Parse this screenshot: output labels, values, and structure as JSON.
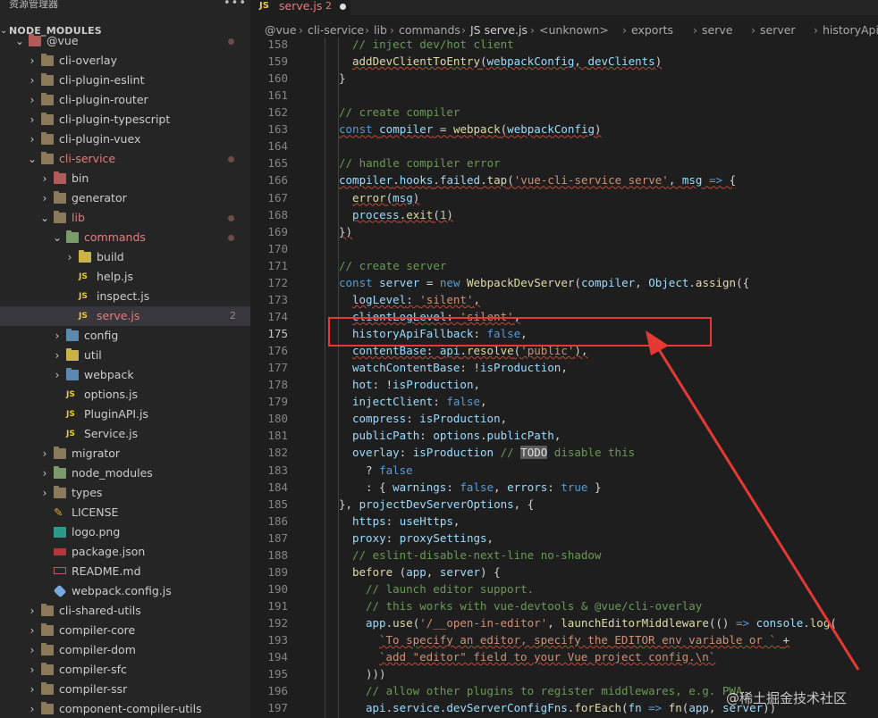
{
  "sidebar": {
    "title": "资源管理器",
    "menu": "•••",
    "section": "NODE_MODULES",
    "items": [
      {
        "label": "@vue",
        "type": "folder",
        "color": "red",
        "depth": 0,
        "open": true,
        "dot": true
      },
      {
        "label": "cli-overlay",
        "type": "folder",
        "color": "default",
        "depth": 1
      },
      {
        "label": "cli-plugin-eslint",
        "type": "folder",
        "color": "default",
        "depth": 1
      },
      {
        "label": "cli-plugin-router",
        "type": "folder",
        "color": "default",
        "depth": 1
      },
      {
        "label": "cli-plugin-typescript",
        "type": "folder",
        "color": "default",
        "depth": 1
      },
      {
        "label": "cli-plugin-vuex",
        "type": "folder",
        "color": "default",
        "depth": 1
      },
      {
        "label": "cli-service",
        "type": "folder",
        "color": "default",
        "depth": 1,
        "open": true,
        "red": true,
        "dot": true
      },
      {
        "label": "bin",
        "type": "folder",
        "color": "red",
        "depth": 2
      },
      {
        "label": "generator",
        "type": "folder",
        "color": "default",
        "depth": 2
      },
      {
        "label": "lib",
        "type": "folder",
        "color": "default",
        "depth": 2,
        "open": true,
        "red": true,
        "dot": true
      },
      {
        "label": "commands",
        "type": "folder",
        "color": "green",
        "depth": 3,
        "open": true,
        "red": true,
        "dot": true
      },
      {
        "label": "build",
        "type": "folder",
        "color": "yellow",
        "depth": 4
      },
      {
        "label": "help.js",
        "type": "js",
        "depth": 4
      },
      {
        "label": "inspect.js",
        "type": "js",
        "depth": 4
      },
      {
        "label": "serve.js",
        "type": "js",
        "depth": 4,
        "red": true,
        "count": "2",
        "selected": true
      },
      {
        "label": "config",
        "type": "folder",
        "color": "blue",
        "depth": 3
      },
      {
        "label": "util",
        "type": "folder",
        "color": "yellow",
        "depth": 3
      },
      {
        "label": "webpack",
        "type": "folder",
        "color": "blue",
        "depth": 3
      },
      {
        "label": "options.js",
        "type": "js",
        "depth": 3
      },
      {
        "label": "PluginAPI.js",
        "type": "js",
        "depth": 3
      },
      {
        "label": "Service.js",
        "type": "js",
        "depth": 3
      },
      {
        "label": "migrator",
        "type": "folder",
        "color": "default",
        "depth": 2
      },
      {
        "label": "node_modules",
        "type": "folder",
        "color": "green",
        "depth": 2
      },
      {
        "label": "types",
        "type": "folder",
        "color": "default",
        "depth": 2
      },
      {
        "label": "LICENSE",
        "type": "license",
        "depth": 2
      },
      {
        "label": "logo.png",
        "type": "image",
        "depth": 2
      },
      {
        "label": "package.json",
        "type": "npm",
        "depth": 2
      },
      {
        "label": "README.md",
        "type": "md",
        "depth": 2
      },
      {
        "label": "webpack.config.js",
        "type": "webpack",
        "depth": 2
      },
      {
        "label": "cli-shared-utils",
        "type": "folder",
        "color": "default",
        "depth": 1
      },
      {
        "label": "compiler-core",
        "type": "folder",
        "color": "default",
        "depth": 1
      },
      {
        "label": "compiler-dom",
        "type": "folder",
        "color": "default",
        "depth": 1
      },
      {
        "label": "compiler-sfc",
        "type": "folder",
        "color": "default",
        "depth": 1
      },
      {
        "label": "compiler-ssr",
        "type": "folder",
        "color": "default",
        "depth": 1
      },
      {
        "label": "component-compiler-utils",
        "type": "folder",
        "color": "default",
        "depth": 1
      }
    ]
  },
  "tab": {
    "icon": "JS",
    "name": "serve.js",
    "problems": "2"
  },
  "breadcrumb": [
    "@vue",
    "cli-service",
    "lib",
    "commands",
    "JS serve.js",
    "<unknown>",
    "exports",
    "serve",
    "server",
    "historyApiFallback"
  ],
  "editor": {
    "current_line": 175,
    "lines": [
      {
        "n": 158,
        "i": 2,
        "t": [
          [
            "cm",
            "// inject dev/hot client"
          ]
        ]
      },
      {
        "n": 159,
        "i": 2,
        "t": [
          [
            "fn",
            "addDevClientToEntry"
          ],
          [
            "tx",
            "("
          ],
          [
            "vr",
            "webpackConfig"
          ],
          [
            "tx",
            ", "
          ],
          [
            "vr",
            "devClients"
          ],
          [
            "tx",
            ")"
          ]
        ]
      },
      {
        "n": 160,
        "i": 1,
        "t": [
          [
            "tx",
            "}"
          ]
        ]
      },
      {
        "n": 161,
        "i": 0,
        "t": []
      },
      {
        "n": 162,
        "i": 1,
        "t": [
          [
            "cm",
            "// create compiler"
          ]
        ]
      },
      {
        "n": 163,
        "i": 1,
        "t": [
          [
            "kw",
            "const "
          ],
          [
            "vr",
            "compiler"
          ],
          [
            "tx",
            " = "
          ],
          [
            "fn",
            "webpack"
          ],
          [
            "tx",
            "("
          ],
          [
            "vr",
            "webpackConfig"
          ],
          [
            "tx",
            ")"
          ]
        ]
      },
      {
        "n": 164,
        "i": 0,
        "t": []
      },
      {
        "n": 165,
        "i": 1,
        "t": [
          [
            "cm",
            "// handle compiler error"
          ]
        ]
      },
      {
        "n": 166,
        "i": 1,
        "t": [
          [
            "vr",
            "compiler"
          ],
          [
            "tx",
            "."
          ],
          [
            "pr",
            "hooks"
          ],
          [
            "tx",
            "."
          ],
          [
            "pr",
            "failed"
          ],
          [
            "tx",
            "."
          ],
          [
            "fn",
            "tap"
          ],
          [
            "tx",
            "("
          ],
          [
            "st",
            "'vue-cli-service serve'"
          ],
          [
            "tx",
            ", "
          ],
          [
            "vr",
            "msg"
          ],
          [
            "tx",
            " "
          ],
          [
            "kw",
            "=>"
          ],
          [
            "tx",
            " {"
          ]
        ]
      },
      {
        "n": 167,
        "i": 2,
        "t": [
          [
            "fn",
            "error"
          ],
          [
            "tx",
            "("
          ],
          [
            "vr",
            "msg"
          ],
          [
            "tx",
            ")"
          ]
        ]
      },
      {
        "n": 168,
        "i": 2,
        "t": [
          [
            "vr",
            "process"
          ],
          [
            "tx",
            "."
          ],
          [
            "fn",
            "exit"
          ],
          [
            "tx",
            "("
          ],
          [
            "nu",
            "1"
          ],
          [
            "tx",
            ")"
          ]
        ]
      },
      {
        "n": 169,
        "i": 1,
        "t": [
          [
            "tx",
            "})"
          ]
        ]
      },
      {
        "n": 170,
        "i": 0,
        "t": []
      },
      {
        "n": 171,
        "i": 1,
        "t": [
          [
            "cm",
            "// create server"
          ]
        ]
      },
      {
        "n": 172,
        "i": 1,
        "t": [
          [
            "kw",
            "const "
          ],
          [
            "vr",
            "server"
          ],
          [
            "tx",
            " = "
          ],
          [
            "kw",
            "new "
          ],
          [
            "fn",
            "WebpackDevServer"
          ],
          [
            "tx",
            "("
          ],
          [
            "vr",
            "compiler"
          ],
          [
            "tx",
            ", "
          ],
          [
            "vr",
            "Object"
          ],
          [
            "tx",
            "."
          ],
          [
            "fn",
            "assign"
          ],
          [
            "tx",
            "({"
          ]
        ]
      },
      {
        "n": 173,
        "i": 2,
        "t": [
          [
            "pr",
            "logLevel"
          ],
          [
            "tx",
            ": "
          ],
          [
            "st",
            "'silent'"
          ],
          [
            "tx",
            ","
          ]
        ]
      },
      {
        "n": 174,
        "i": 2,
        "t": [
          [
            "pr",
            "clientLogLevel"
          ],
          [
            "tx",
            ": "
          ],
          [
            "st",
            "'silent'"
          ],
          [
            "tx",
            ","
          ]
        ]
      },
      {
        "n": 175,
        "i": 2,
        "t": [
          [
            "pr",
            "historyApiFallback"
          ],
          [
            "tx",
            ": "
          ],
          [
            "kw",
            "false"
          ],
          [
            "tx",
            ","
          ]
        ]
      },
      {
        "n": 176,
        "i": 2,
        "t": [
          [
            "pr",
            "contentBase"
          ],
          [
            "tx",
            ": "
          ],
          [
            "vr",
            "api"
          ],
          [
            "tx",
            "."
          ],
          [
            "fn",
            "resolve"
          ],
          [
            "tx",
            "("
          ],
          [
            "st",
            "'public'"
          ],
          [
            "tx",
            "),"
          ]
        ]
      },
      {
        "n": 177,
        "i": 2,
        "t": [
          [
            "pr",
            "watchContentBase"
          ],
          [
            "tx",
            ": !"
          ],
          [
            "vr",
            "isProduction"
          ],
          [
            "tx",
            ","
          ]
        ]
      },
      {
        "n": 178,
        "i": 2,
        "t": [
          [
            "pr",
            "hot"
          ],
          [
            "tx",
            ": !"
          ],
          [
            "vr",
            "isProduction"
          ],
          [
            "tx",
            ","
          ]
        ]
      },
      {
        "n": 179,
        "i": 2,
        "t": [
          [
            "pr",
            "injectClient"
          ],
          [
            "tx",
            ": "
          ],
          [
            "kw",
            "false"
          ],
          [
            "tx",
            ","
          ]
        ]
      },
      {
        "n": 180,
        "i": 2,
        "t": [
          [
            "pr",
            "compress"
          ],
          [
            "tx",
            ": "
          ],
          [
            "vr",
            "isProduction"
          ],
          [
            "tx",
            ","
          ]
        ]
      },
      {
        "n": 181,
        "i": 2,
        "t": [
          [
            "pr",
            "publicPath"
          ],
          [
            "tx",
            ": "
          ],
          [
            "vr",
            "options"
          ],
          [
            "tx",
            "."
          ],
          [
            "pr",
            "publicPath"
          ],
          [
            "tx",
            ","
          ]
        ]
      },
      {
        "n": 182,
        "i": 2,
        "t": [
          [
            "pr",
            "overlay"
          ],
          [
            "tx",
            ": "
          ],
          [
            "vr",
            "isProduction"
          ],
          [
            "tx",
            " "
          ],
          [
            "cm",
            "// "
          ],
          [
            "todo",
            "TODO"
          ],
          [
            "cm",
            " disable this"
          ]
        ]
      },
      {
        "n": 183,
        "i": 3,
        "t": [
          [
            "tx",
            "? "
          ],
          [
            "kw",
            "false"
          ]
        ]
      },
      {
        "n": 184,
        "i": 3,
        "t": [
          [
            "tx",
            ": { "
          ],
          [
            "pr",
            "warnings"
          ],
          [
            "tx",
            ": "
          ],
          [
            "kw",
            "false"
          ],
          [
            "tx",
            ", "
          ],
          [
            "pr",
            "errors"
          ],
          [
            "tx",
            ": "
          ],
          [
            "kw",
            "true"
          ],
          [
            "tx",
            " }"
          ]
        ]
      },
      {
        "n": 185,
        "i": 1,
        "t": [
          [
            "tx",
            "}, "
          ],
          [
            "vr",
            "projectDevServerOptions"
          ],
          [
            "tx",
            ", {"
          ]
        ]
      },
      {
        "n": 186,
        "i": 2,
        "t": [
          [
            "pr",
            "https"
          ],
          [
            "tx",
            ": "
          ],
          [
            "vr",
            "useHttps"
          ],
          [
            "tx",
            ","
          ]
        ]
      },
      {
        "n": 187,
        "i": 2,
        "t": [
          [
            "pr",
            "proxy"
          ],
          [
            "tx",
            ": "
          ],
          [
            "vr",
            "proxySettings"
          ],
          [
            "tx",
            ","
          ]
        ]
      },
      {
        "n": 188,
        "i": 2,
        "t": [
          [
            "cm",
            "// eslint-disable-next-line no-shadow"
          ]
        ]
      },
      {
        "n": 189,
        "i": 2,
        "t": [
          [
            "fn",
            "before"
          ],
          [
            "tx",
            " ("
          ],
          [
            "vr",
            "app"
          ],
          [
            "tx",
            ", "
          ],
          [
            "vr",
            "server"
          ],
          [
            "tx",
            ") {"
          ]
        ]
      },
      {
        "n": 190,
        "i": 3,
        "t": [
          [
            "cm",
            "// launch editor support."
          ]
        ]
      },
      {
        "n": 191,
        "i": 3,
        "t": [
          [
            "cm",
            "// this works with vue-devtools & @vue/cli-overlay"
          ]
        ]
      },
      {
        "n": 192,
        "i": 3,
        "t": [
          [
            "vr",
            "app"
          ],
          [
            "tx",
            "."
          ],
          [
            "fn",
            "use"
          ],
          [
            "tx",
            "("
          ],
          [
            "st",
            "'/__open-in-editor'"
          ],
          [
            "tx",
            ", "
          ],
          [
            "fn",
            "launchEditorMiddleware"
          ],
          [
            "tx",
            "(() "
          ],
          [
            "kw",
            "=>"
          ],
          [
            "tx",
            " "
          ],
          [
            "vr",
            "console"
          ],
          [
            "tx",
            "."
          ],
          [
            "fn",
            "log"
          ],
          [
            "tx",
            "("
          ]
        ]
      },
      {
        "n": 193,
        "i": 4,
        "t": [
          [
            "st",
            "`To specify an editor, specify the EDITOR env variable or ` "
          ],
          [
            "tx",
            "+"
          ]
        ]
      },
      {
        "n": 194,
        "i": 4,
        "t": [
          [
            "st",
            "`add \"editor\" field to your Vue project config.\\n`"
          ]
        ]
      },
      {
        "n": 195,
        "i": 3,
        "t": [
          [
            "tx",
            ")))"
          ]
        ]
      },
      {
        "n": 196,
        "i": 3,
        "t": [
          [
            "cm",
            "// allow other plugins to register middlewares, e.g. PWA"
          ]
        ]
      },
      {
        "n": 197,
        "i": 3,
        "t": [
          [
            "vr",
            "api"
          ],
          [
            "tx",
            "."
          ],
          [
            "pr",
            "service"
          ],
          [
            "tx",
            "."
          ],
          [
            "pr",
            "devServerConfigFns"
          ],
          [
            "tx",
            "."
          ],
          [
            "fn",
            "forEach"
          ],
          [
            "tx",
            "("
          ],
          [
            "vr",
            "fn"
          ],
          [
            "tx",
            " "
          ],
          [
            "kw",
            "=>"
          ],
          [
            "tx",
            " "
          ],
          [
            "fn",
            "fn"
          ],
          [
            "tx",
            "("
          ],
          [
            "vr",
            "app"
          ],
          [
            "tx",
            ", "
          ],
          [
            "vr",
            "server"
          ],
          [
            "tx",
            "))"
          ]
        ]
      }
    ]
  },
  "watermark": "@稀土掘金技术社区",
  "annotation": {
    "color": "#e53935"
  }
}
